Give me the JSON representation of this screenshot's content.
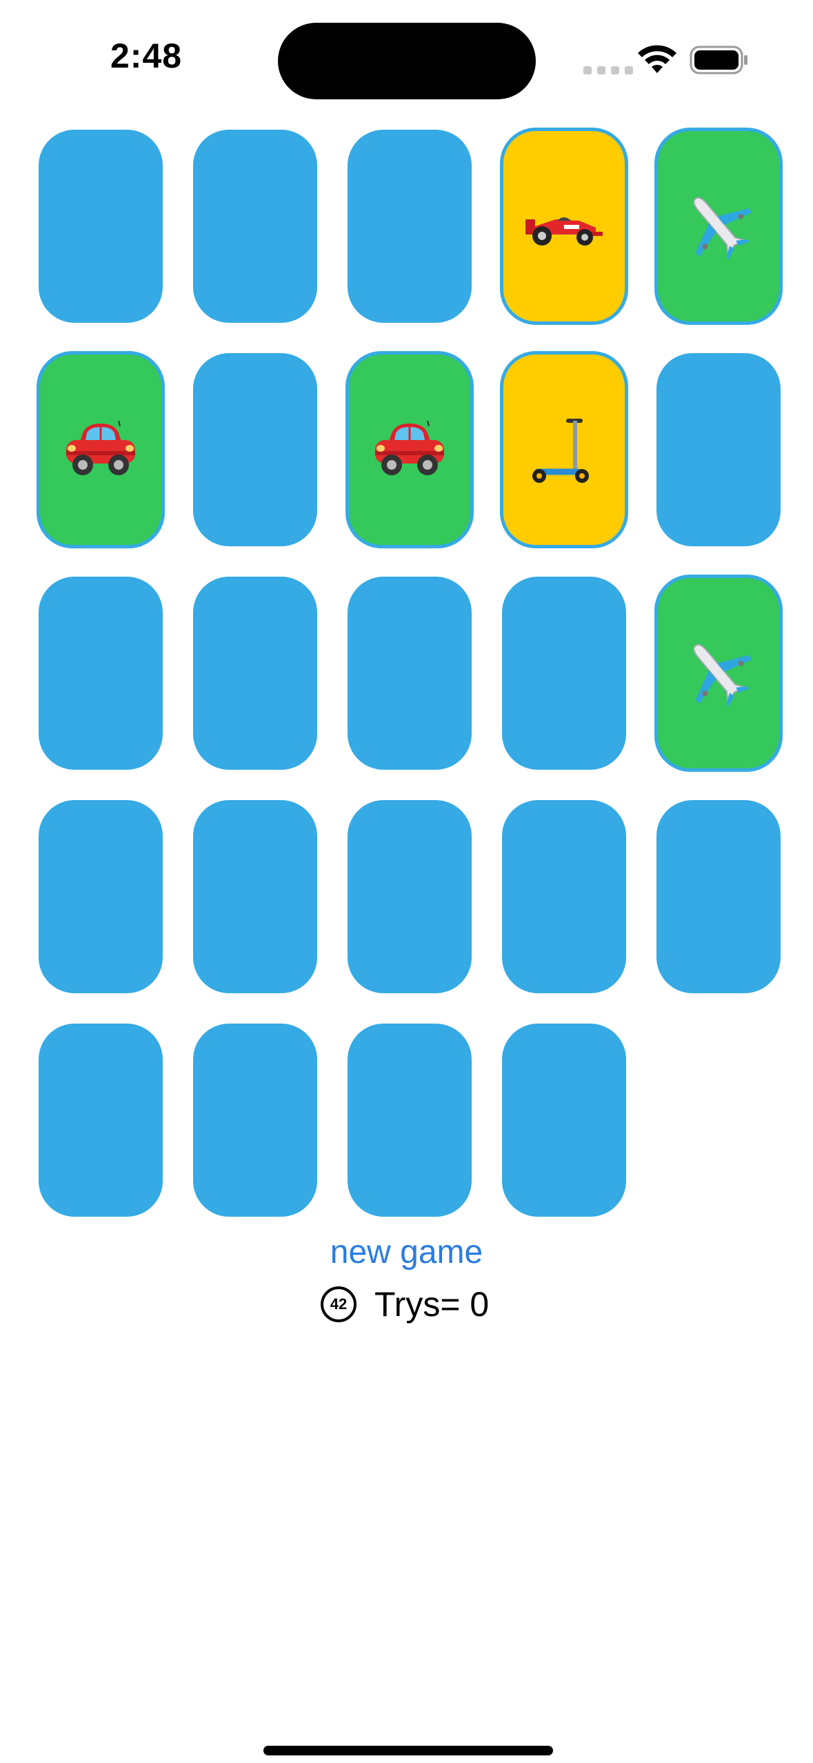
{
  "status_bar": {
    "time": "2:48"
  },
  "cards": [
    {
      "state": "down"
    },
    {
      "state": "down"
    },
    {
      "state": "down"
    },
    {
      "state": "flipped",
      "emoji": "racecar"
    },
    {
      "state": "matched",
      "emoji": "airplane"
    },
    {
      "state": "matched",
      "emoji": "car"
    },
    {
      "state": "down"
    },
    {
      "state": "matched",
      "emoji": "car"
    },
    {
      "state": "flipped",
      "emoji": "scooter"
    },
    {
      "state": "down"
    },
    {
      "state": "down"
    },
    {
      "state": "down"
    },
    {
      "state": "down"
    },
    {
      "state": "down"
    },
    {
      "state": "matched",
      "emoji": "airplane"
    },
    {
      "state": "down"
    },
    {
      "state": "down"
    },
    {
      "state": "down"
    },
    {
      "state": "down"
    },
    {
      "state": "down"
    },
    {
      "state": "down"
    },
    {
      "state": "down"
    },
    {
      "state": "down"
    },
    {
      "state": "down"
    }
  ],
  "colors": {
    "card_back": "#35aae4",
    "card_matched": "#35c85a",
    "card_flipped": "#ffcc00",
    "link": "#2a7de1"
  },
  "controls": {
    "new_game_label": "new game",
    "badge_number": "42",
    "trys_text": "Trys= 0"
  }
}
